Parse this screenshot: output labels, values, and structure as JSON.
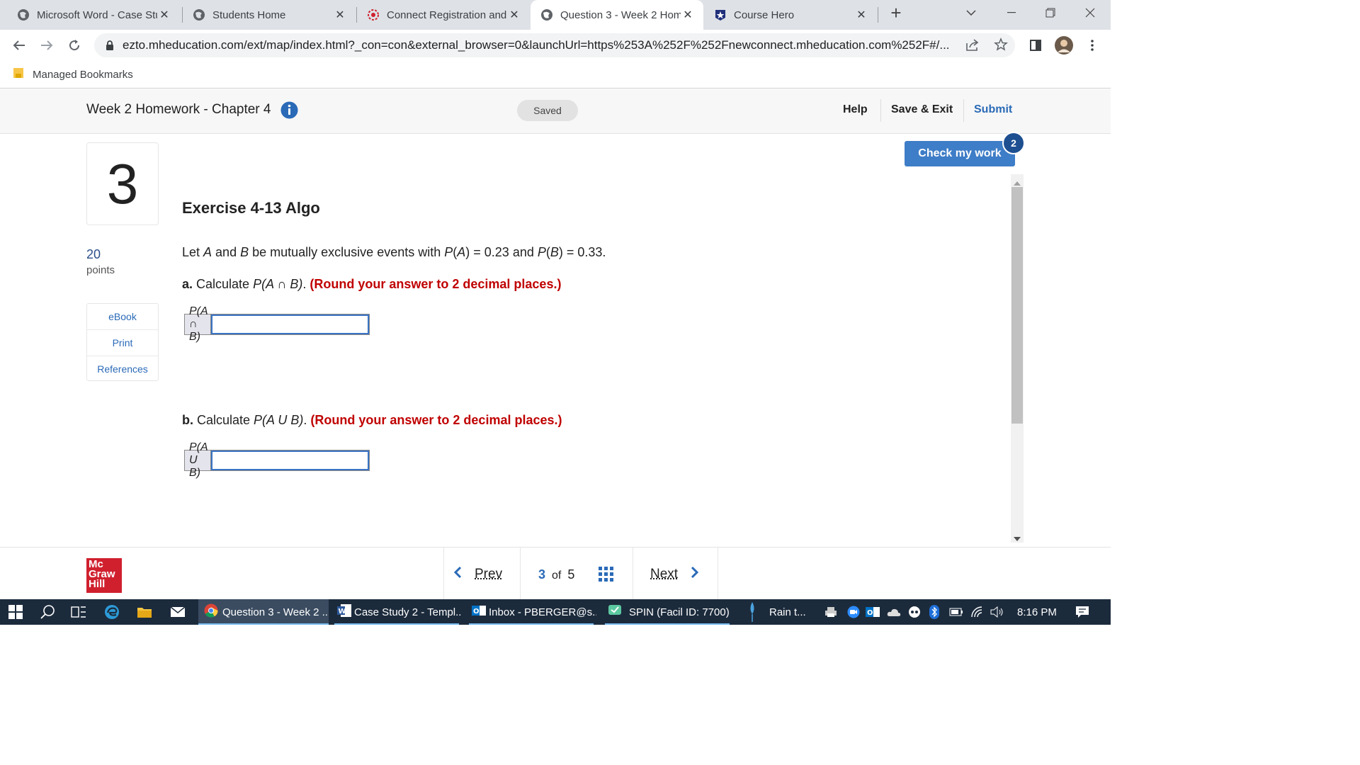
{
  "browser": {
    "tabs": [
      {
        "title": "Microsoft Word - Case Stu",
        "icon": "globe-icon"
      },
      {
        "title": "Students Home",
        "icon": "globe-icon"
      },
      {
        "title": "Connect Registration and",
        "icon": "connect-logo-icon"
      },
      {
        "title": "Question 3 - Week 2 Hom",
        "icon": "globe-icon",
        "active": true
      },
      {
        "title": "Course Hero",
        "icon": "course-hero-star-icon"
      }
    ],
    "url": "ezto.mheducation.com/ext/map/index.html?_con=con&external_browser=0&launchUrl=https%253A%252F%252Fnewconnect.mheducation.com%252F#/...",
    "bookmarks_label": "Managed Bookmarks"
  },
  "app": {
    "assignment_title": "Week 2 Homework - Chapter 4",
    "saved_label": "Saved",
    "help_label": "Help",
    "save_exit_label": "Save & Exit",
    "submit_label": "Submit",
    "check_my_work_label": "Check my work",
    "check_count": "2"
  },
  "question": {
    "number": "3",
    "points_value": "20",
    "points_label": "points",
    "tools": [
      "eBook",
      "Print",
      "References"
    ],
    "exercise_title": "Exercise 4-13 Algo",
    "stem": {
      "t1": "Let ",
      "a": "A",
      "t2": " and ",
      "b": "B",
      "t3": " be mutually exclusive events with ",
      "pa": "P",
      "pa2": "(",
      "pa3": "A",
      "pa4": ") = 0.23 and ",
      "pb": "P",
      "pb2": "(",
      "pb3": "B",
      "pb4": ") = 0.33."
    },
    "part_a": {
      "prefix": "a.",
      "text1": " Calculate ",
      "expr": "P(A ∩ B)",
      "text2": ". ",
      "instruction": "(Round your answer to 2 decimal places.)",
      "answer_label": "P(A ∩ B)",
      "answer_value": ""
    },
    "part_b": {
      "prefix": "b.",
      "text1": " Calculate ",
      "expr": "P(A U B)",
      "text2": ". ",
      "instruction": "(Round your answer to 2 decimal places.)",
      "answer_label": "P(A U B)",
      "answer_value": ""
    }
  },
  "footer": {
    "logo_lines": [
      "Mc",
      "Graw",
      "Hill"
    ],
    "prev_label": "Prev",
    "current_page": "3",
    "of_label": "of",
    "total_pages": "5",
    "next_label": "Next"
  },
  "taskbar": {
    "apps": [
      {
        "label": "Question 3 - Week 2 ...",
        "icon": "chrome-icon"
      },
      {
        "label": "Case Study 2 - Templ...",
        "icon": "word-icon"
      },
      {
        "label": "Inbox - PBERGER@s...",
        "icon": "outlook-icon"
      },
      {
        "label": "SPIN  (Facil ID: 7700)",
        "icon": "spin-icon"
      }
    ],
    "weather": "Rain t...",
    "time": "8:16 PM"
  },
  "colors": {
    "accent_blue": "#2a6ab7",
    "check_button": "#3e7dc7",
    "instruction_red": "#c00000",
    "logo_red": "#d0202e",
    "taskbar_bg": "#1c2b3c"
  }
}
